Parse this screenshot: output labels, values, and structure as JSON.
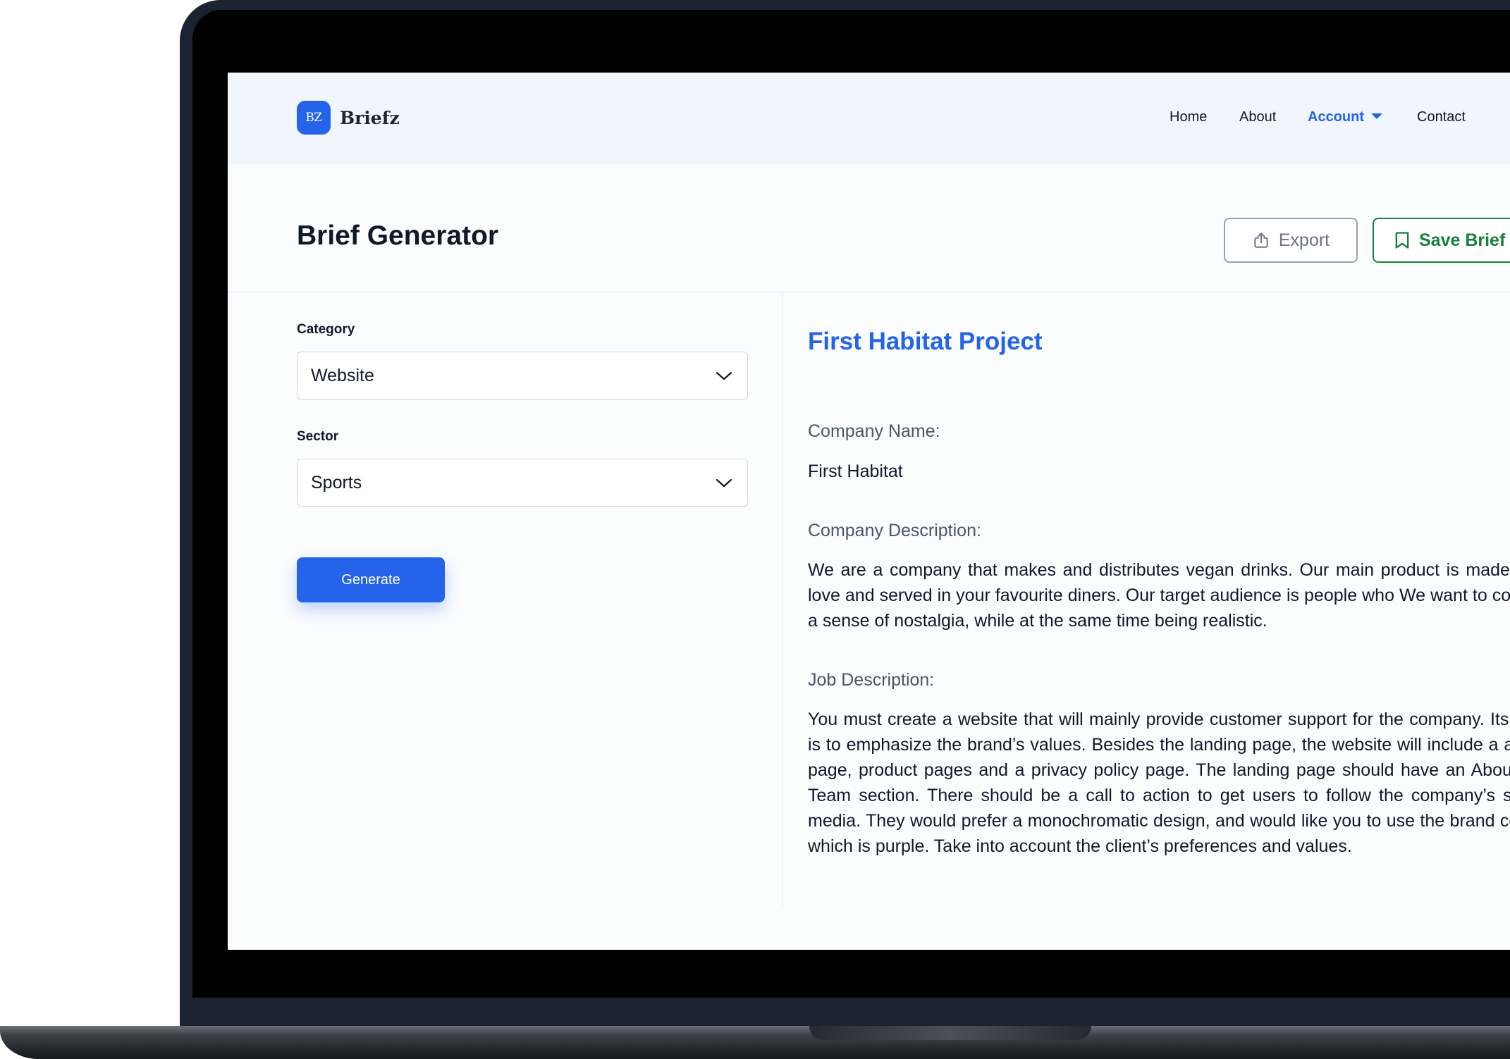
{
  "app": {
    "logo_mark": "BZ",
    "logo_name": "Briefz"
  },
  "nav": {
    "home": "Home",
    "about": "About",
    "account": "Account",
    "contact": "Contact"
  },
  "colors": {
    "accent": "#2563eb",
    "save_green": "#15803d",
    "navbar_bg": "#f1f5fd"
  },
  "header": {
    "title": "Brief Generator",
    "export_label": "Export",
    "save_label": "Save Brief"
  },
  "form": {
    "category_label": "Category",
    "category_value": "Website",
    "sector_label": "Sector",
    "sector_value": "Sports",
    "generate_label": "Generate"
  },
  "brief": {
    "title": "First Habitat Project",
    "company_name_label": "Company Name:",
    "company_name": "First Habitat",
    "company_description_label": "Company Description:",
    "company_description": "We are a company that makes and distributes vegan drinks. Our main product is made with love and served in your favourite diners. Our target audience is people who We want to convey a sense of nostalgia, while at the same time being realistic.",
    "job_description_label": "Job Description:",
    "job_description": "You must create a website that will mainly provide customer support for the company. Its goal is to emphasize the brand’s values. Besides the landing page, the website will include a about page, product pages and a privacy policy page. The landing page should have an About the Team section. There should be a call to action to get users to follow the company’s social media. They would prefer a monochromatic design, and would like you to use the brand colour which is purple. Take into account the client’s preferences and values."
  },
  "icons": [
    "upload-icon",
    "bookmark-icon",
    "chevron-down-icon",
    "caret-down-icon"
  ]
}
